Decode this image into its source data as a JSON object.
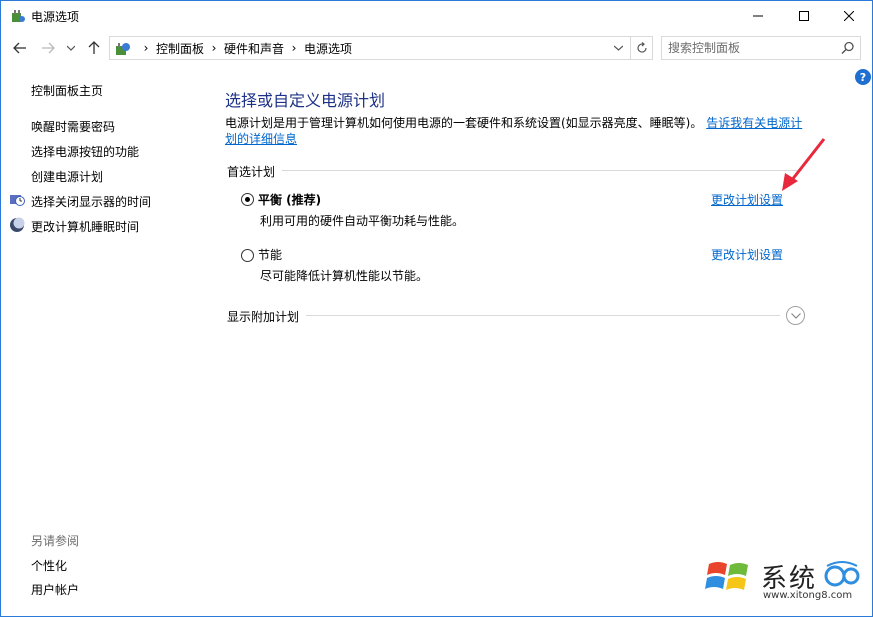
{
  "window": {
    "title": "电源选项"
  },
  "address": {
    "crumbs": [
      "控制面板",
      "硬件和声音",
      "电源选项"
    ],
    "search_placeholder": "搜索控制面板"
  },
  "sidebar": {
    "home": "控制面板主页",
    "links": [
      "唤醒时需要密码",
      "选择电源按钮的功能",
      "创建电源计划",
      "选择关闭显示器的时间",
      "更改计算机睡眠时间"
    ],
    "see_also_heading": "另请参阅",
    "see_also": [
      "个性化",
      "用户帐户"
    ]
  },
  "main": {
    "title": "选择或自定义电源计划",
    "description": "电源计划是用于管理计算机如何使用电源的一套硬件和系统设置(如显示器亮度、睡眠等)。",
    "description_link": "告诉我有关电源计划的详细信息",
    "preferred_heading": "首选计划",
    "plans": [
      {
        "name": "平衡 (推荐)",
        "desc": "利用可用的硬件自动平衡功耗与性能。",
        "link": "更改计划设置",
        "selected": true
      },
      {
        "name": "节能",
        "desc": "尽可能降低计算机性能以节能。",
        "link": "更改计划设置",
        "selected": false
      }
    ],
    "additional_heading": "显示附加计划"
  },
  "watermark": {
    "text": "系统",
    "url": "www.xitong8.com"
  },
  "colors": {
    "accent": "#1e6fcf",
    "link": "#0066cc",
    "title": "#1e3287",
    "annotation_arrow": "#e8283c"
  }
}
